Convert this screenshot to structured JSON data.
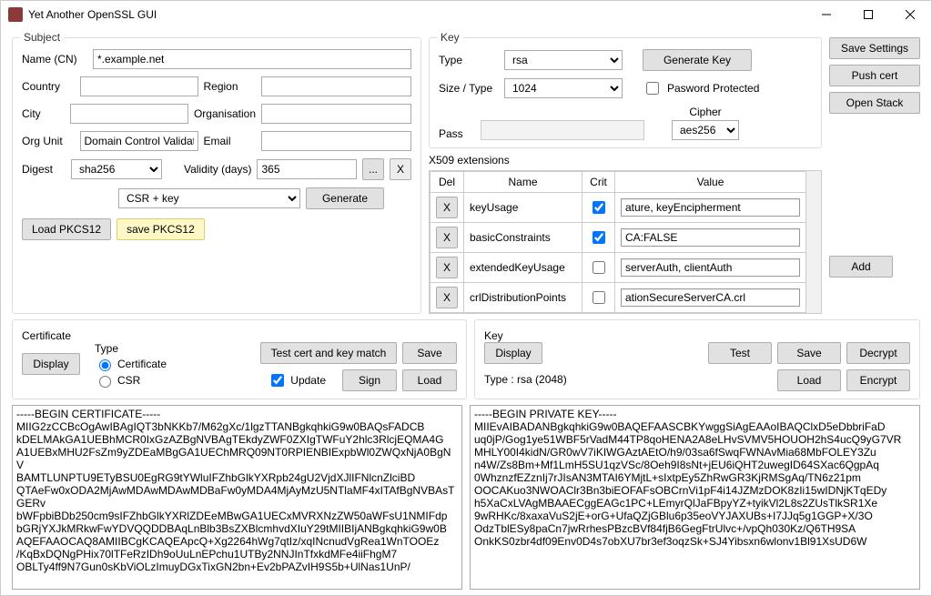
{
  "window": {
    "title": "Yet Another OpenSSL GUI"
  },
  "sidebuttons": {
    "save_settings": "Save Settings",
    "push_cert": "Push cert",
    "open_stack": "Open Stack"
  },
  "subject": {
    "title": "Subject",
    "name_label": "Name (CN)",
    "name_value": "*.example.net",
    "country_label": "Country",
    "country_value": "",
    "region_label": "Region",
    "region_value": "",
    "city_label": "City",
    "city_value": "",
    "org_label": "Organisation",
    "org_value": "",
    "ou_label": "Org Unit",
    "ou_value": "Domain Control Validated",
    "email_label": "Email",
    "email_value": "",
    "digest_label": "Digest",
    "digest_value": "sha256",
    "validity_label": "Validity (days)",
    "validity_value": "365",
    "dots": "...",
    "x": "X",
    "mode_value": "CSR + key",
    "generate": "Generate",
    "load_p12": "Load PKCS12",
    "save_p12": "save PKCS12"
  },
  "key": {
    "title": "Key",
    "type_label": "Type",
    "type_value": "rsa",
    "size_label": "Size / Type",
    "size_value": "1024",
    "pass_label": "Pass",
    "pass_value": "",
    "cipher_label": "Cipher",
    "cipher_value": "aes256",
    "pwd_protected_label": "Pasword Protected",
    "gen_key": "Generate Key",
    "add": "Add"
  },
  "ext": {
    "title": "X509 extensions",
    "col_del": "Del",
    "col_name": "Name",
    "col_crit": "Crit",
    "col_value": "Value",
    "rows": [
      {
        "name": "keyUsage",
        "crit": true,
        "value": "ature, keyEncipherment"
      },
      {
        "name": "basicConstraints",
        "crit": true,
        "value": "CA:FALSE"
      },
      {
        "name": "extendedKeyUsage",
        "crit": false,
        "value": "serverAuth, clientAuth"
      },
      {
        "name": "crlDistributionPoints",
        "crit": false,
        "value": "ationSecureServerCA.crl"
      }
    ],
    "delbtn": "X"
  },
  "cert": {
    "title": "Certificate",
    "display": "Display",
    "type_label": "Type",
    "radio_cert": "Certificate",
    "radio_csr": "CSR",
    "test_match": "Test cert and key match",
    "save": "Save",
    "sign": "Sign",
    "load": "Load",
    "update_label": "Update"
  },
  "keydisp": {
    "title": "Key",
    "display": "Display",
    "type_line": "Type :  rsa (2048)",
    "test": "Test",
    "save": "Save",
    "decrypt": "Decrypt",
    "load": "Load",
    "encrypt": "Encrypt"
  },
  "cert_text": "-----BEGIN CERTIFICATE-----\nMIIG2zCCBcOgAwIBAgIQT3bNKKb7/M62gXc/1lgzTTANBgkqhkiG9w0BAQsFADCB\nkDELMAkGA1UEBhMCR0IxGzAZBgNVBAgTEkdyZWF0ZXIgTWFuY2hlc3RlcjEQMA4G\nA1UEBxMHU2FsZm9yZDEaMBgGA1UEChMRQ09NT0RPIENBIExpbWl0ZWQxNjA0BgNV\nBAMTLUNPTU9ETyBSU0EgRG9tYWluIFZhbGlkYXRpb24gU2VjdXJlIFNlcnZlciBD\nQTAeFw0xODA2MjAwMDAwMDAwMDBaFw0yMDA4MjAyMzU5NTlaMF4xITAfBgNVBAsTGERv\nbWFpbiBDb250cm9sIFZhbGlkYXRlZDEeMBwGA1UECxMVRXNzZW50aWFsU1NMIFdp\nbGRjYXJkMRkwFwYDVQQDDBAqLnBlb3BsZXBlcmhvdXIuY29tMIIBIjANBgkqhkiG9w0B\nAQEFAAOCAQ8AMIIBCgKCAQEApcQ+Xg2264hWg7qtIz/xqINcnudVgRea1WnTOOEz\n/KqBxDQNgPHix70lTFeRzIDh9oUuLnEPchu1UTBy2NNJInTfxkdMFe4iiFhgM7\nOBLTy4ff9N7Gun0sKbViOLzImuyDGxTixGN2bn+Ev2bPAZvIH9S5b+UlNas1UnP/",
  "key_text": "-----BEGIN PRIVATE KEY-----\nMIIEvAIBADANBgkqhkiG9w0BAQEFAASCBKYwggSiAgEAAoIBAQClxD5eDbbriFaD\nuq0jP/Gog1ye51WBF5rVadM44TP8qoHENA2A8eLHvSVMV5HOUOH2hS4ucQ9yG7VR\nMHLY00I4kidN/GR0wV7iKIWGAztAEtO/h9/03sa6fSwqFWNAvMia68MbFOLEY3Zu\nn4W/Zs8Bm+Mf1LmH5SU1qzVSc/8Oeh9I8sNt+jEU6iQHT2uwegID64SXac6QgpAq\n0WhznzfEZznIj7rJIsAN3MTAI6YMjtL+sIxtpEy5ZhRwGR3KjRMSgAq/TN6z21pm\nOOCAKuo3NWOAClr3Bn3biEOFAFsOBCrnVi1pF4i14JZMzDOK8zIi15wIDNjKTqEDy\nh5XaCxLVAgMBAAECggEAGc1PC+LEmyrQlJaFBpyYZ+tyikVl2L8s2ZUsTlkSR1Xe\n9wRHKc/8xaxaVuS2jE+orG+UfaQZjGBlu6p35eoVYJAXUBs+I7JJq5g1GGP+X/3O\nOdzTblESy8paCn7jwRrhesPBzcBVf84fjB6GegFtrUlvc+/vpQh030Kz/Q6TH9SA\nOnkKS0zbr4df09Env0D4s7obXU7br3ef3oqzSk+SJ4Yibsxn6wlonv1Bl91XsUD6W"
}
